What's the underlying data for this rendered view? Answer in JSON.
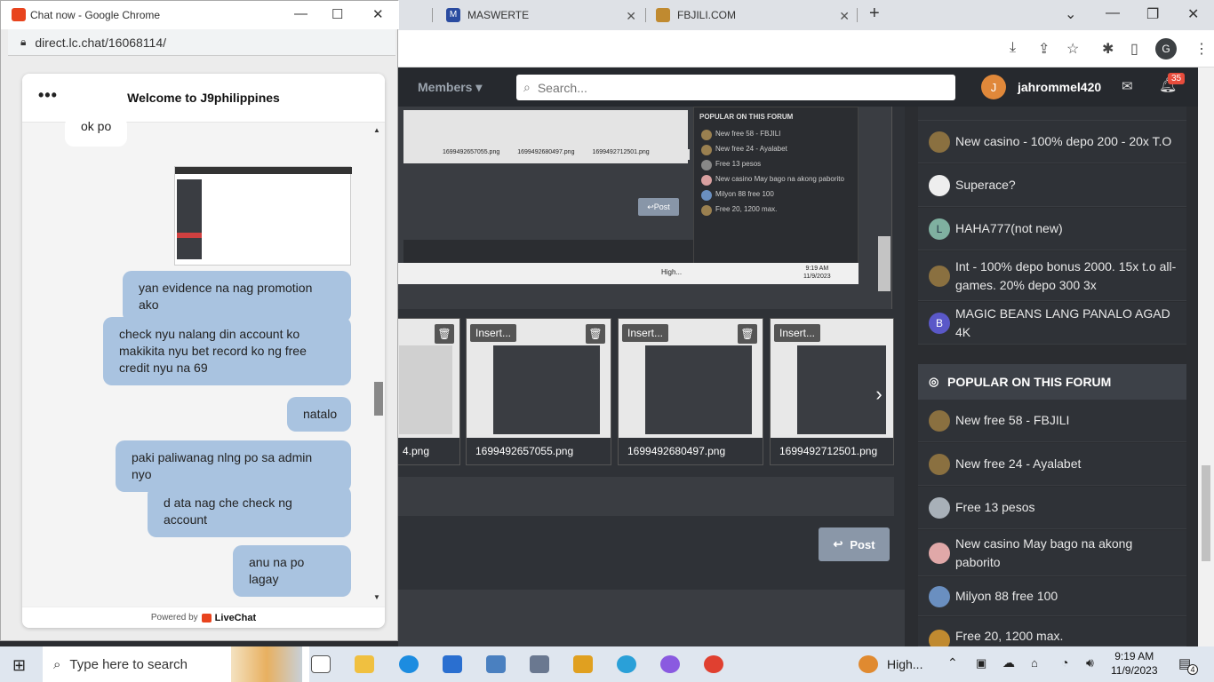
{
  "browser": {
    "tabs": [
      {
        "label": "MASWERTE"
      },
      {
        "label": "FBJILI.COM"
      }
    ],
    "new_tab": "+",
    "profile_initial": "G"
  },
  "site_header": {
    "members": "Members",
    "search_placeholder": "Search...",
    "avatar_letter": "J",
    "username": "jahrommel420",
    "notif_count": "35"
  },
  "screenshot_inset": {
    "popular_title": "POPULAR ON THIS FORUM",
    "items": [
      "New free 58 - FBJILI",
      "New free 24 - Ayalabet",
      "Free 13 pesos",
      "New casino May bago na akong paborito",
      "Milyon 88 free 100",
      "Free 20, 1200 max."
    ],
    "post_label": "Post",
    "thumb_names": [
      "1699492657055.png",
      "1699492680497.png",
      "1699492712501.png"
    ],
    "clock_time": "9:19 AM",
    "clock_date": "11/9/2023",
    "weather": "High..."
  },
  "attachments": [
    {
      "insert": "Insert...",
      "filename": "4.png"
    },
    {
      "insert": "Insert...",
      "filename": "1699492657055.png"
    },
    {
      "insert": "Insert...",
      "filename": "1699492680497.png"
    },
    {
      "insert": "Insert...",
      "filename": "1699492712501.png"
    }
  ],
  "post_button": "Post",
  "sidebar": {
    "latest": [
      {
        "title": "New casino - 100% depo 200 - 20x T.O"
      },
      {
        "title": "Superace?"
      },
      {
        "title": "HAHA777(not new)",
        "avatar_letter": "L"
      },
      {
        "title": "Int - 100% depo bonus 2000. 15x t.o all-games. 20% depo 300 3x"
      },
      {
        "title": "MAGIC BEANS LANG PANALO AGAD 4K",
        "avatar_letter": "B"
      }
    ],
    "popular_title": "POPULAR ON THIS FORUM",
    "popular": [
      {
        "title": "New free 58 - FBJILI"
      },
      {
        "title": "New free 24 - Ayalabet"
      },
      {
        "title": "Free 13 pesos"
      },
      {
        "title": "New casino May bago na akong paborito"
      },
      {
        "title": "Milyon 88 free 100"
      },
      {
        "title": "Free 20, 1200 max."
      }
    ]
  },
  "chat": {
    "window_title": "Chat now - Google Chrome",
    "url": "direct.lc.chat/16068114/",
    "header_title": "Welcome to J9philippines",
    "messages": [
      {
        "from": "agent",
        "text": "ok po"
      },
      {
        "from": "visitor",
        "text": "yan evidence na nag promotion ako"
      },
      {
        "from": "visitor",
        "text": "check nyu nalang din account ko makikita nyu bet record ko ng free credit nyu na 69"
      },
      {
        "from": "visitor",
        "text": "natalo"
      },
      {
        "from": "visitor",
        "text": "paki paliwanag nlng po sa admin nyo"
      },
      {
        "from": "visitor",
        "text": "d ata nag che check ng account"
      },
      {
        "from": "visitor",
        "text": "anu na po lagay"
      }
    ],
    "powered_by": "Powered by",
    "brand": "LiveChat"
  },
  "taskbar": {
    "search_placeholder": "Type here to search",
    "weather": "High...",
    "time": "9:19 AM",
    "date": "11/9/2023",
    "notif_count": "4"
  }
}
